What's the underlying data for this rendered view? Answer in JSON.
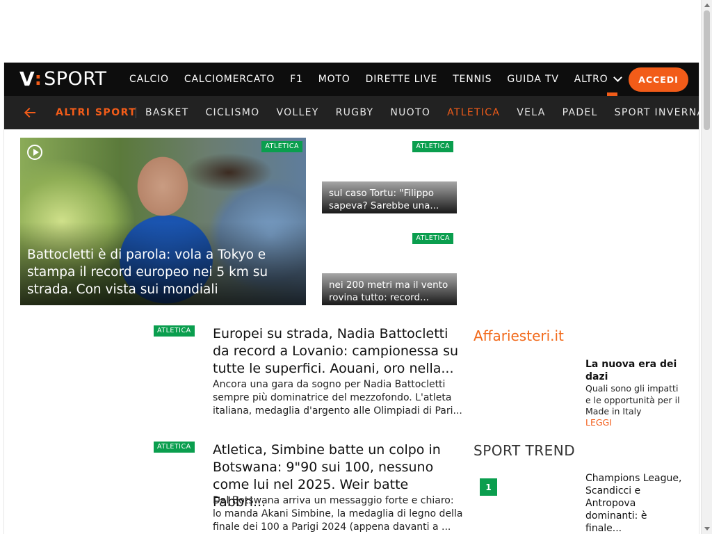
{
  "brand": {
    "logo_v": "V",
    "logo_colon": ":",
    "logo_sport": "SPORT"
  },
  "main_nav": {
    "items": [
      "CALCIO",
      "CALCIOMERCATO",
      "F1",
      "MOTO",
      "DIRETTE LIVE",
      "TENNIS",
      "GUIDA TV",
      "ALTRO"
    ],
    "login_label": "ACCEDI"
  },
  "sub_nav": {
    "title": "ALTRI SPORT",
    "items": [
      "BASKET",
      "CICLISMO",
      "VOLLEY",
      "RUGBY",
      "NUOTO",
      "ATLETICA",
      "VELA",
      "PADEL",
      "SPORT INVERNALI"
    ],
    "active": "ATLETICA"
  },
  "hero": {
    "tag": "ATLETICA",
    "title": "Battocletti è di parola: vola a Tokyo e stampa il record europeo nei 5 km su strada. Con vista sui mondiali"
  },
  "side_cards": [
    {
      "tag": "ATLETICA",
      "title": "sul caso Tortu: \"Filippo sapeva? Sarebbe una..."
    },
    {
      "tag": "ATLETICA",
      "title": "nei 200 metri ma il vento rovina tutto: record..."
    }
  ],
  "articles": [
    {
      "tag": "ATLETICA",
      "title": "Europei su strada, Nadia Battocletti da record a Lovanio: campionessa su tutte le superfici. Aouani, oro nella...",
      "excerpt": "Ancora una gara da sogno per Nadia Battocletti sempre più dominatrice del mezzofondo. L'atleta italiana, medaglia d'argento alle Olimpiadi di Pari..."
    },
    {
      "tag": "ATLETICA",
      "title": "Atletica, Simbine batte un colpo in Botswana: 9\"90 sui 100, nessuno come lui nel 2025. Weir batte Fabbri...",
      "excerpt": "Dal Botswana arriva un messaggio forte e chiaro: lo manda Akani Simbine, la medaglia di legno della finale dei 100 a Parigi 2024 (appena davanti a ..."
    }
  ],
  "affari": {
    "logo": "Affariesteri.it",
    "title": "La nuova era dei dazi",
    "description": "Quali sono gli impatti e le opportunità per il Made in Italy",
    "link": "LEGGI"
  },
  "sport_trend": {
    "heading": "SPORT TREND",
    "items": [
      {
        "rank": "1",
        "text": "Champions League, Scandicci e Antropova dominanti: è finale..."
      }
    ]
  },
  "colors": {
    "accent": "#f25c19",
    "tag_green": "#0a9e4e",
    "nav_dark": "#0d0d0d",
    "subnav": "#222222"
  }
}
